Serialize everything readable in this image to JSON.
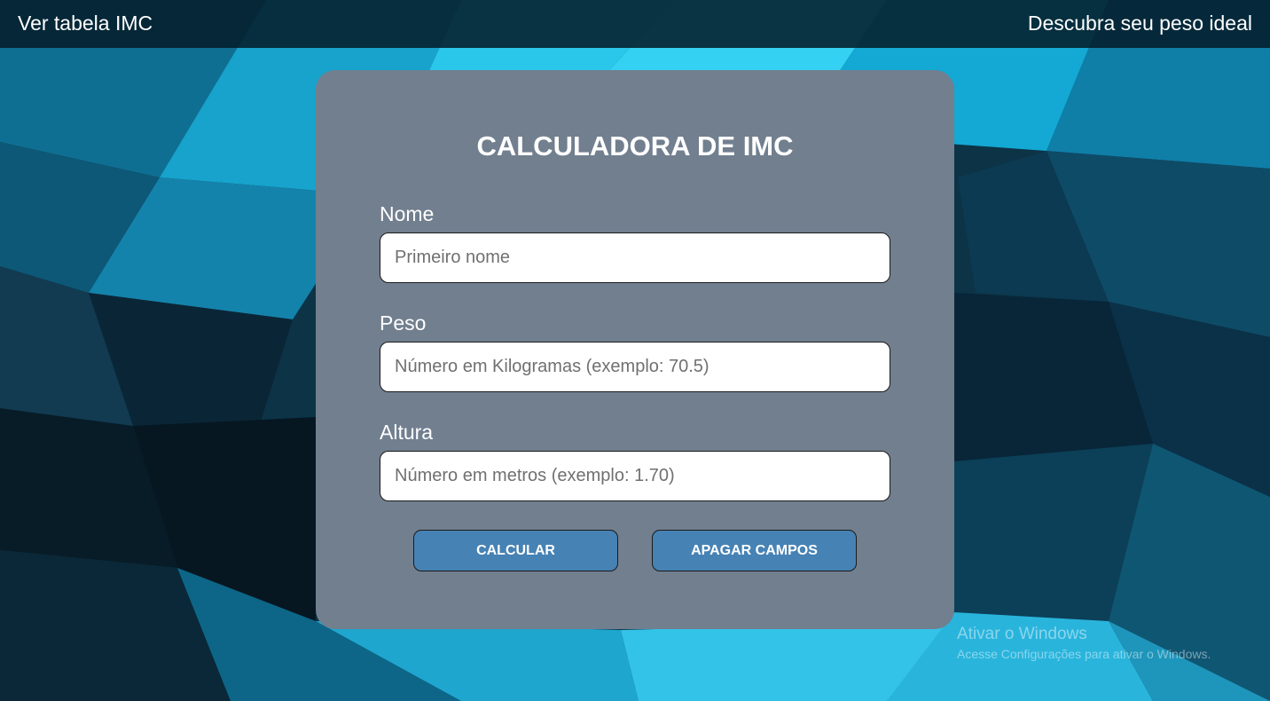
{
  "header": {
    "left_link": "Ver tabela IMC",
    "right_link": "Descubra seu peso ideal"
  },
  "form": {
    "title": "CALCULADORA DE IMC",
    "fields": [
      {
        "label": "Nome",
        "placeholder": "Primeiro nome",
        "value": ""
      },
      {
        "label": "Peso",
        "placeholder": "Número em Kilogramas (exemplo: 70.5)",
        "value": ""
      },
      {
        "label": "Altura",
        "placeholder": "Número em metros (exemplo: 1.70)",
        "value": ""
      }
    ],
    "buttons": {
      "calculate": "CALCULAR",
      "clear": "APAGAR CAMPOS"
    }
  },
  "watermark": {
    "line1": "Ativar o Windows",
    "line2": "Acesse Configurações para ativar o Windows."
  },
  "colors": {
    "card_background": "#717f8f",
    "button_background": "#4682b4",
    "topbar_background": "#051e2a"
  }
}
